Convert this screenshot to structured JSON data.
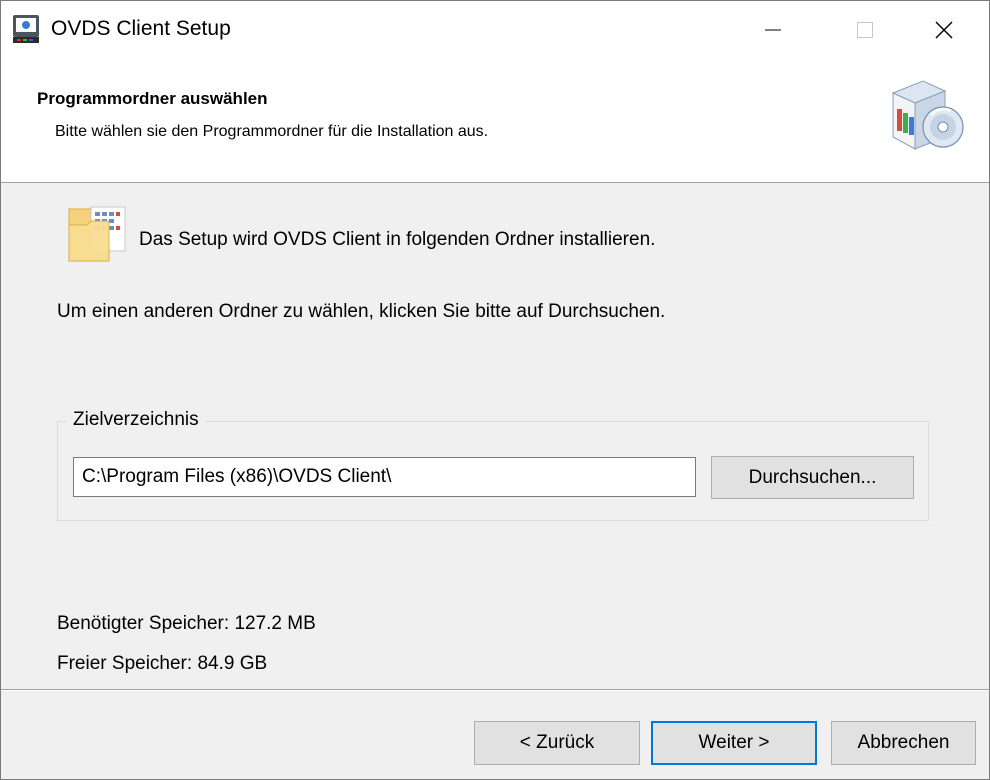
{
  "window": {
    "title": "OVDS Client Setup",
    "controls": {
      "minimize": "minimize",
      "maximize": "maximize",
      "close": "close"
    }
  },
  "header": {
    "title": "Programmordner auswählen",
    "subtitle": "Bitte wählen sie den Programmordner für die Installation aus."
  },
  "content": {
    "intro": "Das Setup wird OVDS Client in folgenden Ordner installieren.",
    "instruction": "Um einen anderen Ordner zu wählen, klicken Sie bitte auf Durchsuchen.",
    "destination": {
      "group_label": "Zielverzeichnis",
      "path_value": "C:\\Program Files (x86)\\OVDS Client\\",
      "browse_label": "Durchsuchen..."
    },
    "space_required": "Benötigter Speicher:  127.2 MB",
    "space_free": "Freier Speicher:  84.9 GB"
  },
  "footer": {
    "back_label": "< Zurück",
    "next_label": "Weiter >",
    "cancel_label": "Abbrechen"
  },
  "icons": {
    "app": "setup-app-icon",
    "header": "software-box-cd-icon",
    "folder": "folder-icon"
  },
  "colors": {
    "accent": "#0078d7",
    "background": "#f0f0f0",
    "button": "#e1e1e1"
  }
}
